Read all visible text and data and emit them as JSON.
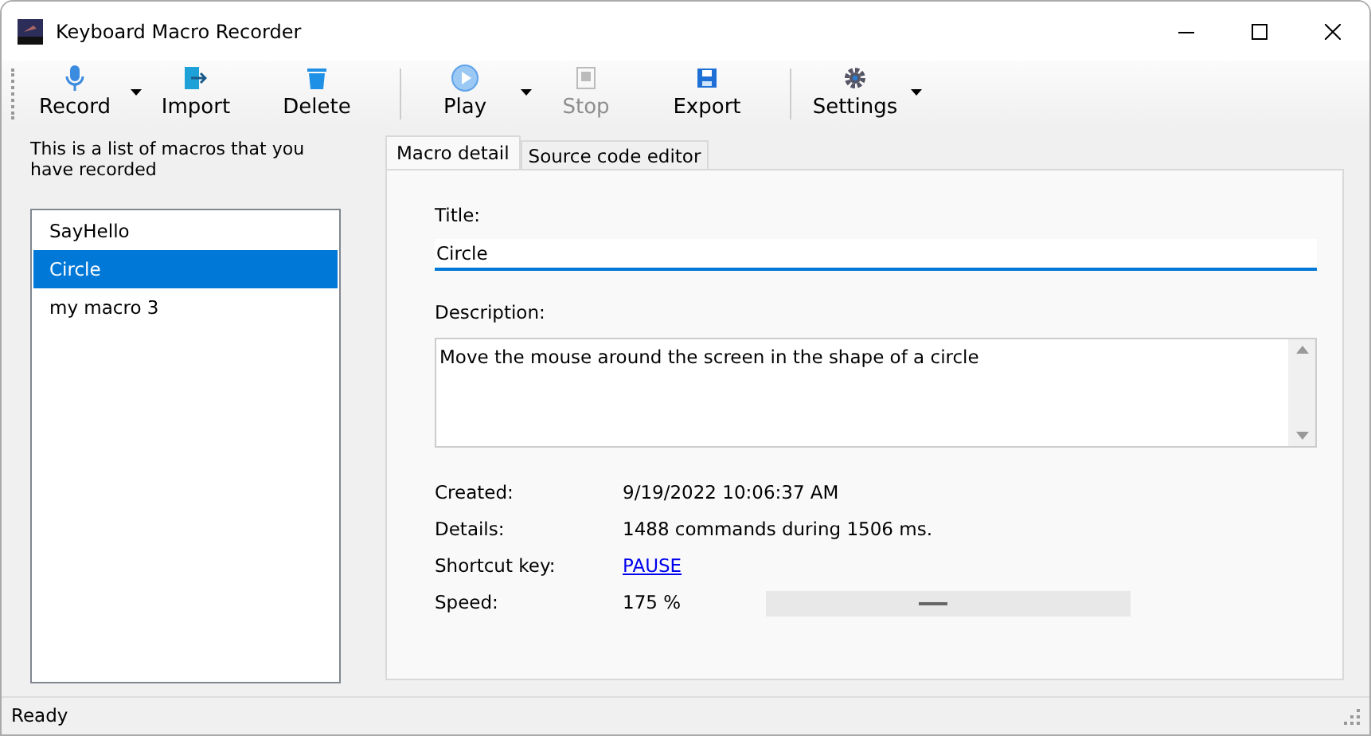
{
  "window": {
    "title": "Keyboard Macro Recorder"
  },
  "toolbar": [
    {
      "kind": "button",
      "label": "Record",
      "dropdown": true,
      "disabled": false
    },
    {
      "kind": "button",
      "label": "Import",
      "dropdown": false,
      "disabled": false
    },
    {
      "kind": "button",
      "label": "Delete",
      "dropdown": false,
      "disabled": false
    },
    {
      "kind": "separator"
    },
    {
      "kind": "button",
      "label": "Play",
      "dropdown": true,
      "disabled": false
    },
    {
      "kind": "button",
      "label": "Stop",
      "dropdown": false,
      "disabled": true
    },
    {
      "kind": "button",
      "label": "Export",
      "dropdown": false,
      "disabled": false
    },
    {
      "kind": "separator"
    },
    {
      "kind": "button",
      "label": "Settings",
      "dropdown": true,
      "disabled": false
    }
  ],
  "sidebar": {
    "caption": "This is a list of macros that you have recorded",
    "items": [
      {
        "label": "SayHello",
        "selected": false
      },
      {
        "label": "Circle",
        "selected": true
      },
      {
        "label": "my macro 3",
        "selected": false
      }
    ]
  },
  "tabs": [
    {
      "label": "Macro detail",
      "selected": true
    },
    {
      "label": "Source code editor",
      "selected": false
    }
  ],
  "detail": {
    "title_label": "Title:",
    "title_value": "Circle",
    "description_label": "Description:",
    "description_value": "Move the mouse around the screen in the shape of a circle",
    "rows": [
      {
        "label": "Created:",
        "value": "9/19/2022 10:06:37 AM",
        "kind": "text"
      },
      {
        "label": "Details:",
        "value": "1488 commands during 1506 ms.",
        "kind": "text"
      },
      {
        "label": "Shortcut key:",
        "value": "PAUSE",
        "kind": "link"
      },
      {
        "label": "Speed:",
        "value": "175 %",
        "kind": "slider",
        "level": 0.46
      }
    ]
  },
  "status_bar": "Ready"
}
